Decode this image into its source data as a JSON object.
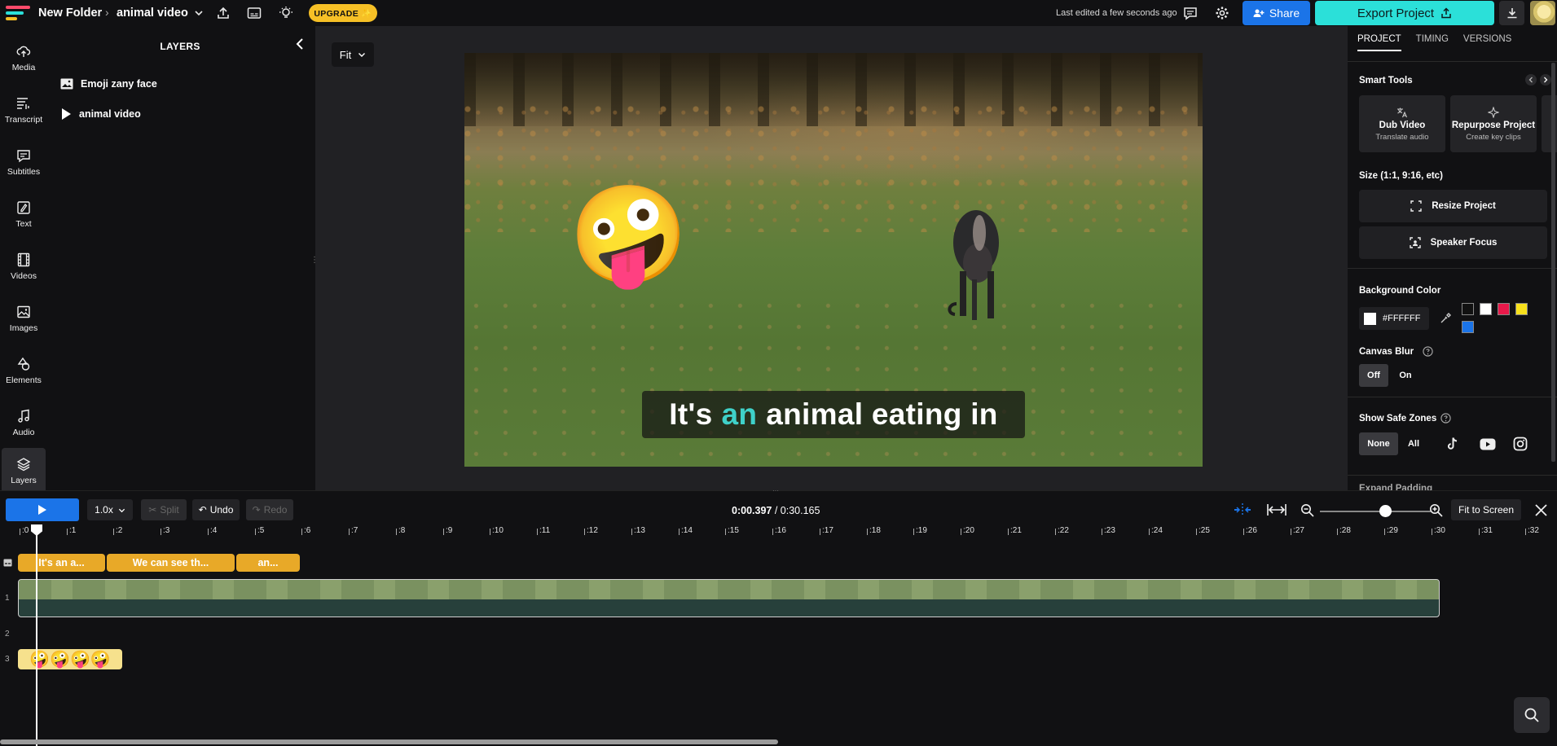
{
  "topbar": {
    "folder": "New Folder",
    "project": "animal video",
    "upgrade": "UPGRADE ✨",
    "last_edited": "Last edited a few seconds ago",
    "share": "Share",
    "export": "Export Project"
  },
  "nav": [
    {
      "label": "Media",
      "icon": "upload-icon"
    },
    {
      "label": "Transcript",
      "icon": "transcript-icon"
    },
    {
      "label": "Subtitles",
      "icon": "subtitles-icon"
    },
    {
      "label": "Text",
      "icon": "text-icon"
    },
    {
      "label": "Videos",
      "icon": "film-icon"
    },
    {
      "label": "Images",
      "icon": "image-icon"
    },
    {
      "label": "Elements",
      "icon": "shapes-icon"
    },
    {
      "label": "Audio",
      "icon": "music-note-icon"
    },
    {
      "label": "Layers",
      "icon": "layers-icon"
    }
  ],
  "layers": {
    "title": "LAYERS",
    "items": [
      {
        "label": "Emoji zany face",
        "icon": "image-icon"
      },
      {
        "label": "animal video",
        "icon": "play-icon"
      }
    ]
  },
  "canvas": {
    "fit": "Fit",
    "caption_pre": "It's",
    "caption_hl": "an",
    "caption_post": "animal eating in",
    "emoji": "🤪"
  },
  "right": {
    "tabs": [
      "PROJECT",
      "TIMING",
      "VERSIONS"
    ],
    "smart_tools": "Smart Tools",
    "cards": [
      {
        "title": "Dub Video",
        "sub": "Translate audio"
      },
      {
        "title": "Repurpose Project",
        "sub": "Create key clips"
      }
    ],
    "size_label": "Size (1:1, 9:16, etc)",
    "resize": "Resize Project",
    "speaker_focus": "Speaker Focus",
    "bg_color": "Background Color",
    "bg_value": "#FFFFFF",
    "swatches": [
      "#111111",
      "#FFFFFF",
      "#E8194A",
      "#F7E01C",
      "#1B74E8"
    ],
    "canvas_blur": "Canvas Blur",
    "blur_off": "Off",
    "blur_on": "On",
    "safe_zones": "Show Safe Zones",
    "sz_none": "None",
    "sz_all": "All",
    "expand_padding": "Expand Padding"
  },
  "timeline": {
    "speed": "1.0x",
    "split": "Split",
    "undo": "Undo",
    "redo": "Redo",
    "current_time": "0:00.397",
    "total_time": "/ 0:30.165",
    "fit_to_screen": "Fit to Screen",
    "ticks": [
      ":0",
      ":1",
      ":2",
      ":3",
      ":4",
      ":5",
      ":6",
      ":7",
      ":8",
      ":9",
      ":10",
      ":11",
      ":12",
      ":13",
      ":14",
      ":15",
      ":16",
      ":17",
      ":18",
      ":19",
      ":20",
      ":21",
      ":22",
      ":23",
      ":24",
      ":25",
      ":26",
      ":27",
      ":28",
      ":29",
      ":30",
      ":31",
      ":32"
    ],
    "subtitle_clips": [
      "It's an a...",
      "We can see th...",
      "an..."
    ],
    "track_numbers": [
      "1",
      "2",
      "3"
    ],
    "emoji_clip": "🤪🤪🤪🤪"
  }
}
